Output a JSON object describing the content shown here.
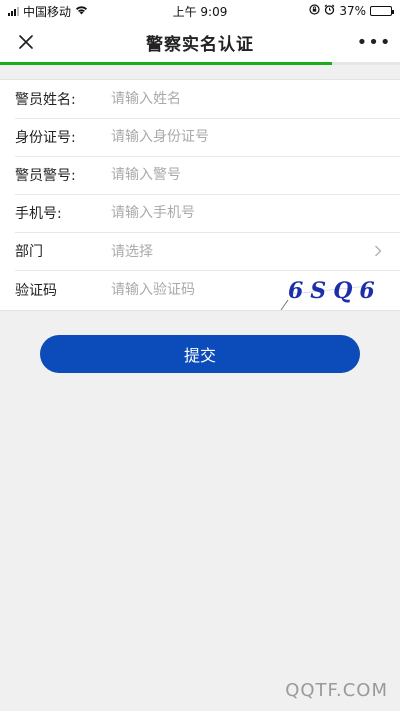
{
  "status_bar": {
    "carrier": "中国移动",
    "time": "上午 9:09",
    "battery": "37%",
    "battery_level": 0.37
  },
  "nav": {
    "title": "警察实名认证",
    "more": "•••",
    "load_progress": 0.83
  },
  "form": {
    "rows": [
      {
        "label": "警员姓名:",
        "placeholder": "请输入姓名"
      },
      {
        "label": "身份证号:",
        "placeholder": "请输入身份证号"
      },
      {
        "label": "警员警号:",
        "placeholder": "请输入警号"
      },
      {
        "label": "手机号:",
        "placeholder": "请输入手机号"
      }
    ],
    "department": {
      "label": "部门",
      "placeholder": "请选择"
    },
    "captcha": {
      "label": "验证码",
      "placeholder": "请输入验证码",
      "image_text": "6SQ6"
    }
  },
  "submit_label": "提交",
  "watermark": "QQTF.COM",
  "colors": {
    "accent": "#0b4cba",
    "progress": "#1aad19"
  }
}
